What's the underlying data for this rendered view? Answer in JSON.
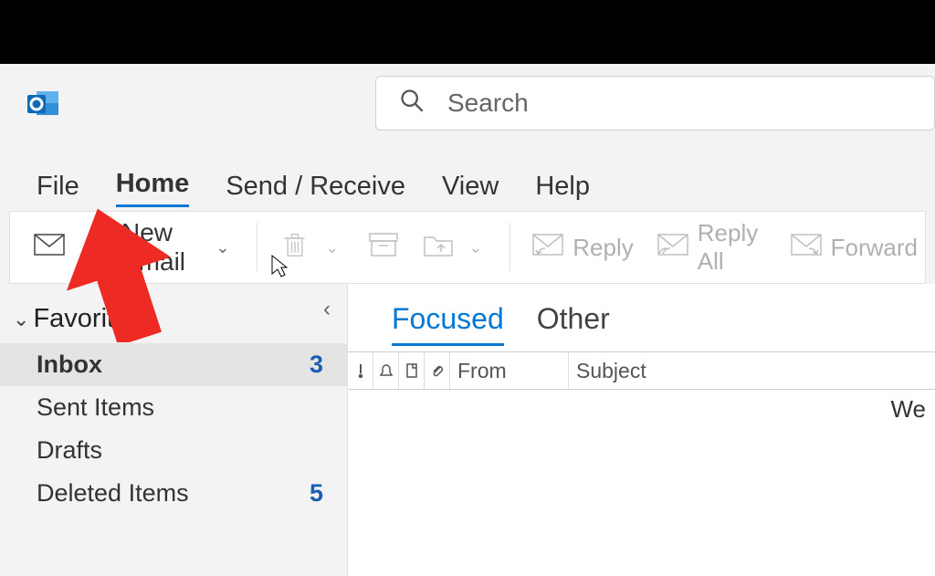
{
  "search": {
    "placeholder": "Search"
  },
  "menu": {
    "file": "File",
    "home": "Home",
    "sendreceive": "Send / Receive",
    "view": "View",
    "help": "Help"
  },
  "ribbon": {
    "newemail": "New Email",
    "reply": "Reply",
    "replyall": "Reply All",
    "forward": "Forward"
  },
  "sidebar": {
    "favorites": "Favorites",
    "items": [
      {
        "label": "Inbox",
        "count": "3"
      },
      {
        "label": "Sent Items",
        "count": ""
      },
      {
        "label": "Drafts",
        "count": ""
      },
      {
        "label": "Deleted Items",
        "count": "5"
      }
    ]
  },
  "mailtabs": {
    "focused": "Focused",
    "other": "Other"
  },
  "columns": {
    "from": "From",
    "subject": "Subject"
  },
  "message_snippet": "We"
}
